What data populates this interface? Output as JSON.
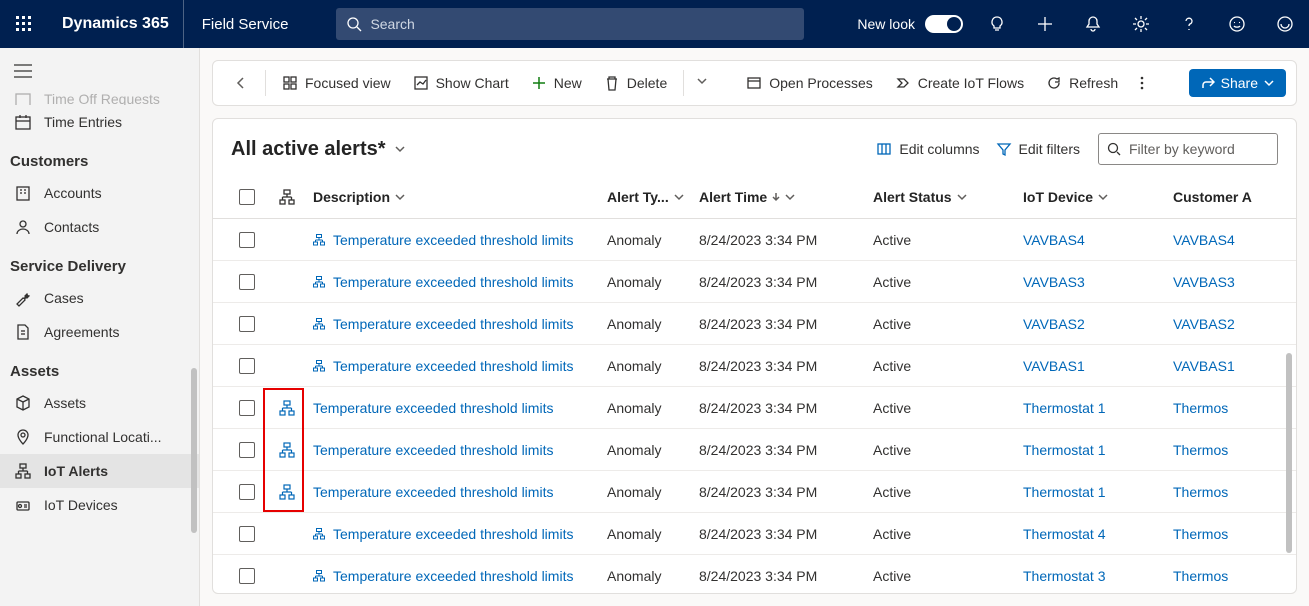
{
  "header": {
    "brand": "Dynamics 365",
    "app": "Field Service",
    "search_placeholder": "Search",
    "new_look_label": "New look"
  },
  "sidebar": {
    "item_requests": "Time Off Requests",
    "item_time_entries": "Time Entries",
    "hdr_customers": "Customers",
    "item_accounts": "Accounts",
    "item_contacts": "Contacts",
    "hdr_service": "Service Delivery",
    "item_cases": "Cases",
    "item_agreements": "Agreements",
    "hdr_assets": "Assets",
    "item_assets": "Assets",
    "item_func_loc": "Functional Locati...",
    "item_iot_alerts": "IoT Alerts",
    "item_iot_devices": "IoT Devices"
  },
  "commands": {
    "focused": "Focused view",
    "show_chart": "Show Chart",
    "new": "New",
    "delete": "Delete",
    "open_proc": "Open Processes",
    "create_flows": "Create IoT Flows",
    "refresh": "Refresh",
    "share": "Share"
  },
  "grid": {
    "title": "All active alerts*",
    "edit_columns": "Edit columns",
    "edit_filters": "Edit filters",
    "filter_placeholder": "Filter by keyword",
    "columns": {
      "description": "Description",
      "alert_type": "Alert Ty...",
      "alert_time": "Alert Time",
      "alert_status": "Alert Status",
      "iot_device": "IoT Device",
      "customer": "Customer A"
    },
    "rows": [
      {
        "hier": false,
        "desc": "Temperature exceeded threshold limits",
        "type": "Anomaly",
        "time": "8/24/2023 3:34 PM",
        "status": "Active",
        "device": "VAVBAS4",
        "cust": "VAVBAS4"
      },
      {
        "hier": false,
        "desc": "Temperature exceeded threshold limits",
        "type": "Anomaly",
        "time": "8/24/2023 3:34 PM",
        "status": "Active",
        "device": "VAVBAS3",
        "cust": "VAVBAS3"
      },
      {
        "hier": false,
        "desc": "Temperature exceeded threshold limits",
        "type": "Anomaly",
        "time": "8/24/2023 3:34 PM",
        "status": "Active",
        "device": "VAVBAS2",
        "cust": "VAVBAS2"
      },
      {
        "hier": false,
        "desc": "Temperature exceeded threshold limits",
        "type": "Anomaly",
        "time": "8/24/2023 3:34 PM",
        "status": "Active",
        "device": "VAVBAS1",
        "cust": "VAVBAS1"
      },
      {
        "hier": true,
        "desc": "Temperature exceeded threshold limits",
        "type": "Anomaly",
        "time": "8/24/2023 3:34 PM",
        "status": "Active",
        "device": "Thermostat 1",
        "cust": "Thermos"
      },
      {
        "hier": true,
        "desc": "Temperature exceeded threshold limits",
        "type": "Anomaly",
        "time": "8/24/2023 3:34 PM",
        "status": "Active",
        "device": "Thermostat 1",
        "cust": "Thermos"
      },
      {
        "hier": true,
        "desc": "Temperature exceeded threshold limits",
        "type": "Anomaly",
        "time": "8/24/2023 3:34 PM",
        "status": "Active",
        "device": "Thermostat 1",
        "cust": "Thermos"
      },
      {
        "hier": false,
        "desc": "Temperature exceeded threshold limits",
        "type": "Anomaly",
        "time": "8/24/2023 3:34 PM",
        "status": "Active",
        "device": "Thermostat 4",
        "cust": "Thermos"
      },
      {
        "hier": false,
        "desc": "Temperature exceeded threshold limits",
        "type": "Anomaly",
        "time": "8/24/2023 3:34 PM",
        "status": "Active",
        "device": "Thermostat 3",
        "cust": "Thermos"
      }
    ]
  }
}
